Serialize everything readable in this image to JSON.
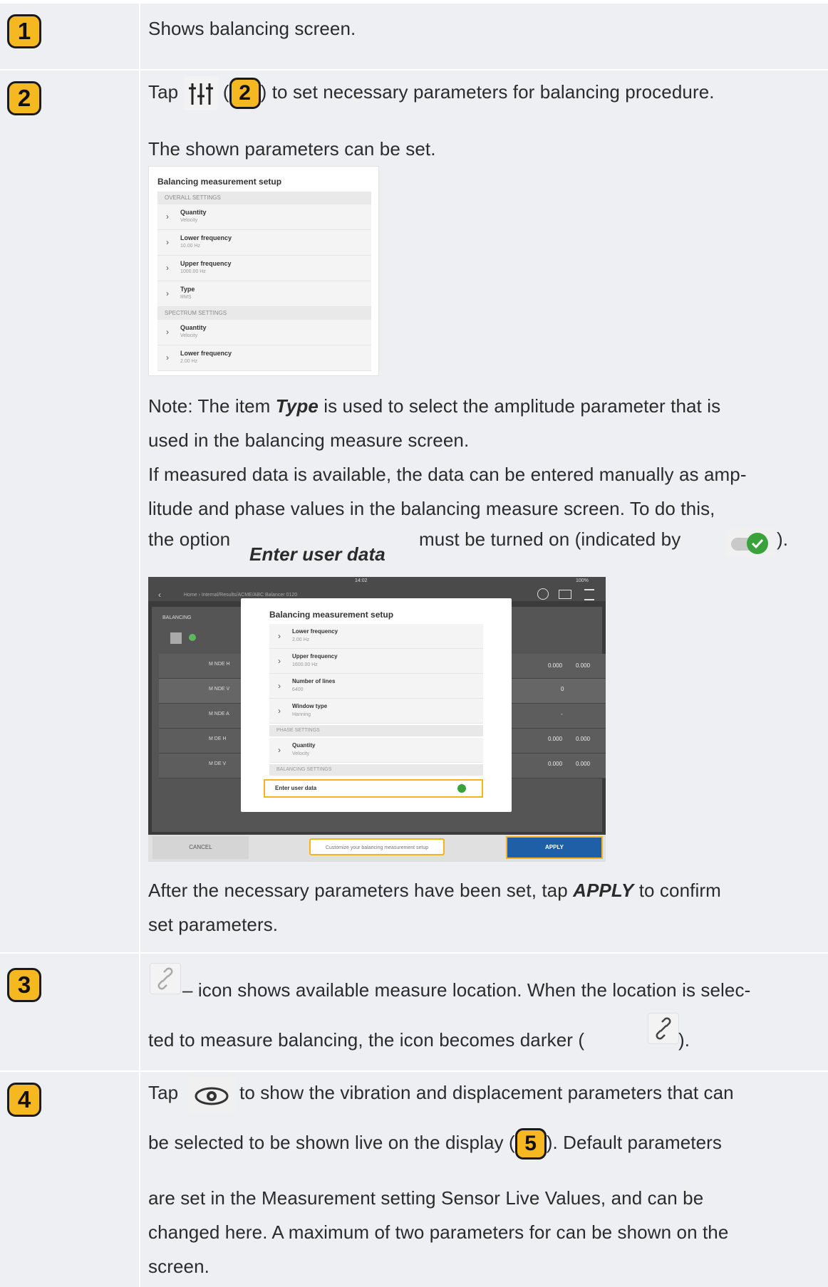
{
  "rows": [
    {
      "number": "1",
      "text": "Shows balancing screen."
    },
    {
      "number": "2",
      "line1_pre": "Tap",
      "line1_badge": "2",
      "line1_post": ") to set necessary parameters for balancing procedure.",
      "line2": "The shown parameters can be set.",
      "note_pre": "Note: The item ",
      "note_bold": "Type",
      "note_post": " is used to select the amplitude parameter that is",
      "note_line2": "used in the balancing measure screen.",
      "measured_line1": "If measured data is available, the data can be entered manually as amp-",
      "measured_line2": "litude and phase values in the balancing measure screen. To do this,",
      "option_pre": "the option",
      "option_bold": "Enter user data",
      "option_post": "must be turned on (indicated by",
      "option_end": ").",
      "after_pre": "After the necessary parameters have been set, tap ",
      "after_bold": "APPLY",
      "after_post": " to confirm",
      "after_line2": "set parameters."
    },
    {
      "number": "3",
      "line1": " – icon shows available measure location. When the location is selec-",
      "line2": "ted to measure balancing, the icon becomes darker (",
      "line2_end": ")."
    },
    {
      "number": "4",
      "line1_pre": "Tap",
      "line1_post": "to show the vibration and displacement parameters that can",
      "line2_pre": "be selected to be shown live on the display (",
      "line2_badge": "5",
      "line2_post": "). Default parameters",
      "line3": "are set in the Measurement setting Sensor Live Values, and can be",
      "line4": "changed here. A maximum of two parameters for can be shown on the",
      "line5": "screen."
    }
  ],
  "setup_screenshot": {
    "title": "Balancing measurement setup",
    "sections": [
      {
        "name": "OVERALL SETTINGS",
        "items": [
          {
            "label": "Quantity",
            "value": "Velocity"
          },
          {
            "label": "Lower frequency",
            "value": "10.00 Hz"
          },
          {
            "label": "Upper frequency",
            "value": "1000.00 Hz"
          },
          {
            "label": "Type",
            "value": "RMS"
          }
        ]
      },
      {
        "name": "SPECTRUM SETTINGS",
        "items": [
          {
            "label": "Quantity",
            "value": "Velocity"
          },
          {
            "label": "Lower frequency",
            "value": "2.00 Hz"
          }
        ]
      }
    ]
  },
  "app_screenshot": {
    "time": "14:02",
    "battery": "100%",
    "breadcrumb": "Home  ›  Internal/Results/ACME/ABC Balancer 0120",
    "panel_title": "BALANCING",
    "locations": [
      "M NDE H",
      "M NDE V",
      "M NDE A",
      "M DE H",
      "M DE V"
    ],
    "modal_title": "Balancing measurement setup",
    "modal_items": [
      {
        "label": "Lower frequency",
        "value": "2.00 Hz"
      },
      {
        "label": "Upper frequency",
        "value": "1600.00 Hz"
      },
      {
        "label": "Number of lines",
        "value": "6400"
      },
      {
        "label": "Window type",
        "value": "Hanning"
      }
    ],
    "phase_section": "PHASE SETTINGS",
    "phase_item": {
      "label": "Quantity",
      "value": "Velocity"
    },
    "balancing_section": "BALANCING SETTINGS",
    "enter_user_data": "Enter user data",
    "values": [
      "0.000",
      "0.000",
      "0",
      "-",
      "0.000",
      "0.000",
      "0.000",
      "0.000"
    ],
    "cancel": "CANCEL",
    "customize": "Customize your balancing measurement setup",
    "apply": "APPLY"
  },
  "colors": {
    "badge": "#f6b820",
    "row_bg": "#edeff2",
    "toggle_on": "#3aa23a",
    "highlight": "#f3b51b"
  },
  "icons": [
    "sliders-icon",
    "toggle-on-icon",
    "link-icon",
    "eye-icon"
  ]
}
